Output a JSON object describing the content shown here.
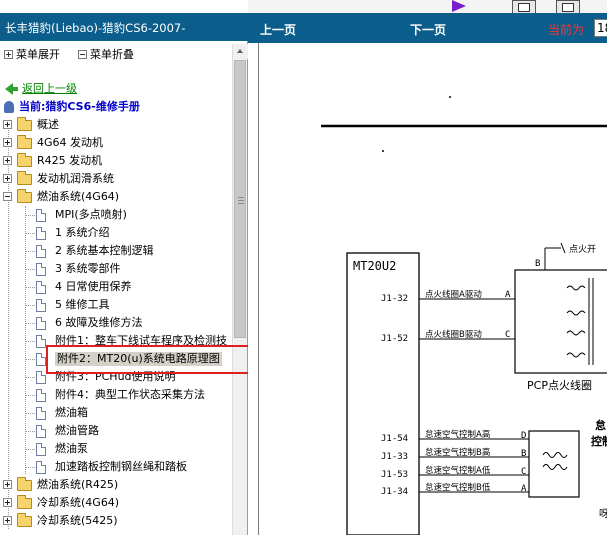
{
  "left": {
    "title": "长丰猎豹(Liebao)-猎豹CS6-2007-",
    "expand_all": "菜单展开",
    "collapse_all": "菜单折叠",
    "back": "返回上一级",
    "current": "当前:猎豹CS6-维修手册",
    "tree": [
      {
        "label": "概述",
        "type": "folder",
        "expanded": false
      },
      {
        "label": "4G64 发动机",
        "type": "folder",
        "expanded": false
      },
      {
        "label": "R425 发动机",
        "type": "folder",
        "expanded": false
      },
      {
        "label": "发动机润滑系统",
        "type": "folder",
        "expanded": false
      },
      {
        "label": "燃油系统(4G64)",
        "type": "folder",
        "expanded": true
      },
      {
        "label": "MPI(多点喷射)",
        "type": "doc"
      },
      {
        "label": "1 系统介绍",
        "type": "doc"
      },
      {
        "label": "2 系统基本控制逻辑",
        "type": "doc"
      },
      {
        "label": "3 系统零部件",
        "type": "doc"
      },
      {
        "label": "4 日常使用保养",
        "type": "doc"
      },
      {
        "label": "5 维修工具",
        "type": "doc"
      },
      {
        "label": "6 故障及维修方法",
        "type": "doc"
      },
      {
        "label": "附件1：整车下线试车程序及检测技",
        "type": "doc"
      },
      {
        "label": "附件2：MT20(u)系统电路原理图",
        "type": "doc",
        "selected": true
      },
      {
        "label": "附件3：PCHud使用说明",
        "type": "doc"
      },
      {
        "label": "附件4：典型工作状态采集方法",
        "type": "doc"
      },
      {
        "label": "燃油箱",
        "type": "doc"
      },
      {
        "label": "燃油管路",
        "type": "doc"
      },
      {
        "label": "燃油泵",
        "type": "doc"
      },
      {
        "label": "加速踏板控制钢丝绳和踏板",
        "type": "doc"
      },
      {
        "label": "燃油系统(R425)",
        "type": "folder",
        "expanded": false
      },
      {
        "label": "冷却系统(4G64)",
        "type": "folder",
        "expanded": false
      },
      {
        "label": "冷却系统(5425)",
        "type": "folder",
        "expanded": false
      }
    ]
  },
  "nav": {
    "prev": "上一页",
    "next": "下一页",
    "current_label": "当前为",
    "page_value": "18"
  },
  "schematic": {
    "module": "MT20U2",
    "pins": [
      "J1-32",
      "J1-52",
      "J1-54",
      "J1-33",
      "J1-53",
      "J1-34"
    ],
    "signals": [
      "点火线圈A驱动",
      "点火线圈B驱动",
      "怠速空气控制A高",
      "怠速空气控制B高",
      "怠速空气控制A低",
      "怠速空气控制B低"
    ],
    "terminals": [
      "A",
      "C",
      "B",
      "D",
      "B",
      "C",
      "A"
    ],
    "coil_label": "PCP点火线圈",
    "right_cut_1": "点火开",
    "right_cut_2": "怠",
    "right_cut_3": "控制",
    "right_cut_4": "呀"
  }
}
